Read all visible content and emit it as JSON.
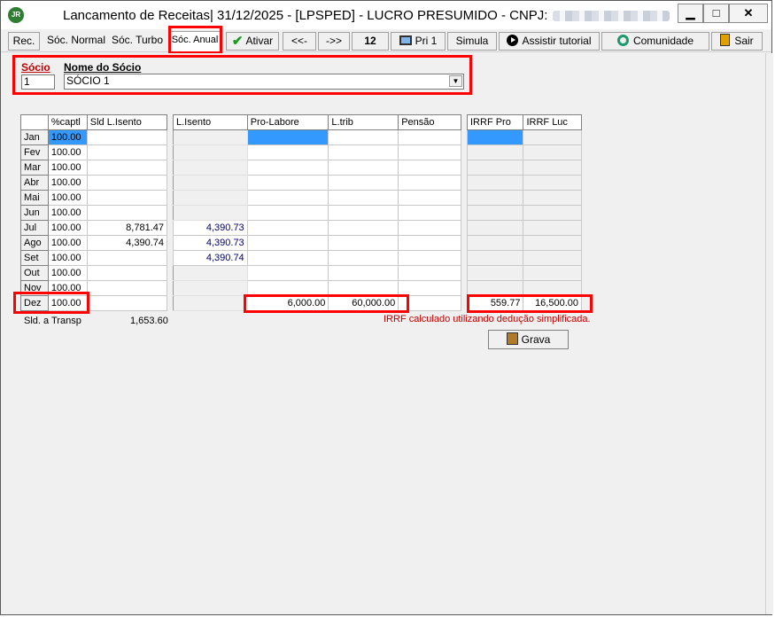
{
  "window": {
    "title": "Lancamento de Receitas|  31/12/2025 - [LPSPED] - LUCRO PRESUMIDO - CNPJ:",
    "app_icon_text": "JR",
    "minimize_glyph": "▁",
    "maximize_glyph": "□",
    "close_glyph": "✕"
  },
  "toolbar": {
    "rec": "Rec.",
    "soc_normal": "Sóc. Normal",
    "soc_turbo": "Sóc. Turbo",
    "soc_anual": "Sóc. Anual",
    "ativar": "Ativar",
    "prev": "<<-",
    "next": "->>",
    "month": "12",
    "pri": "Pri 1",
    "simula": "Simula",
    "tutorial": "Assistir tutorial",
    "comunidade": "Comunidade",
    "sair": "Sair"
  },
  "socio": {
    "label_socio": "Sócio",
    "label_nome": "Nome do Sócio",
    "socio_value": "1",
    "nome_value": "SÓCIO 1"
  },
  "grid": {
    "headers_left": [
      "",
      "%captl",
      "Sld L.Isento"
    ],
    "headers_mid": [
      "L.Isento",
      "Pro-Labore",
      "L.trib",
      "Pensão"
    ],
    "headers_right": [
      "IRRF Pro",
      "IRRF Luc"
    ],
    "rows": [
      {
        "month": "Jan",
        "captl": "100.00",
        "sld": "",
        "lisento": "",
        "prolabore": "",
        "ltrib": "",
        "pensao": "",
        "irrf_pro": "",
        "irrf_luc": ""
      },
      {
        "month": "Fev",
        "captl": "100.00",
        "sld": "",
        "lisento": "",
        "prolabore": "",
        "ltrib": "",
        "pensao": "",
        "irrf_pro": "",
        "irrf_luc": ""
      },
      {
        "month": "Mar",
        "captl": "100.00",
        "sld": "",
        "lisento": "",
        "prolabore": "",
        "ltrib": "",
        "pensao": "",
        "irrf_pro": "",
        "irrf_luc": ""
      },
      {
        "month": "Abr",
        "captl": "100.00",
        "sld": "",
        "lisento": "",
        "prolabore": "",
        "ltrib": "",
        "pensao": "",
        "irrf_pro": "",
        "irrf_luc": ""
      },
      {
        "month": "Mai",
        "captl": "100.00",
        "sld": "",
        "lisento": "",
        "prolabore": "",
        "ltrib": "",
        "pensao": "",
        "irrf_pro": "",
        "irrf_luc": ""
      },
      {
        "month": "Jun",
        "captl": "100.00",
        "sld": "",
        "lisento": "",
        "prolabore": "",
        "ltrib": "",
        "pensao": "",
        "irrf_pro": "",
        "irrf_luc": ""
      },
      {
        "month": "Jul",
        "captl": "100.00",
        "sld": "8,781.47",
        "lisento": "4,390.73",
        "prolabore": "",
        "ltrib": "",
        "pensao": "",
        "irrf_pro": "",
        "irrf_luc": ""
      },
      {
        "month": "Ago",
        "captl": "100.00",
        "sld": "4,390.74",
        "lisento": "4,390.73",
        "prolabore": "",
        "ltrib": "",
        "pensao": "",
        "irrf_pro": "",
        "irrf_luc": ""
      },
      {
        "month": "Set",
        "captl": "100.00",
        "sld": "",
        "lisento": "4,390.74",
        "prolabore": "",
        "ltrib": "",
        "pensao": "",
        "irrf_pro": "",
        "irrf_luc": ""
      },
      {
        "month": "Out",
        "captl": "100.00",
        "sld": "",
        "lisento": "",
        "prolabore": "",
        "ltrib": "",
        "pensao": "",
        "irrf_pro": "",
        "irrf_luc": ""
      },
      {
        "month": "Nov",
        "captl": "100.00",
        "sld": "",
        "lisento": "",
        "prolabore": "",
        "ltrib": "",
        "pensao": "",
        "irrf_pro": "",
        "irrf_luc": ""
      },
      {
        "month": "Dez",
        "captl": "100.00",
        "sld": "",
        "lisento": "",
        "prolabore": "6,000.00",
        "ltrib": "60,000.00",
        "pensao": "",
        "irrf_pro": "559.77",
        "irrf_luc": "16,500.00"
      }
    ]
  },
  "footer": {
    "sld_transp_label": "Sld. a Transp",
    "sld_transp_value": "1,653.60",
    "irrf_note": "IRRF calculado utilizando dedução simplificada.",
    "grava": "Grava"
  },
  "colors": {
    "highlight": "#ff0000",
    "selected_cell": "#3399ff",
    "note_red": "#c00000"
  },
  "icons": {
    "ativar": "check-icon",
    "pri": "monitor-icon",
    "tutorial": "play-icon",
    "comunidade": "globe-icon",
    "sair": "exit-door-icon",
    "grava": "save-icon"
  }
}
